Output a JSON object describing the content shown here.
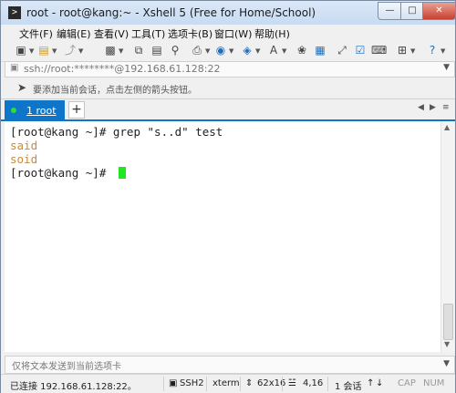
{
  "window": {
    "title": "root - root@kang:~ - Xshell 5 (Free for Home/School)"
  },
  "menu": [
    "文件(F)",
    "编辑(E)",
    "查看(V)",
    "工具(T)",
    "选项卡(B)",
    "窗口(W)",
    "帮助(H)"
  ],
  "address": {
    "value": "ssh://root:********@192.168.61.128:22"
  },
  "hint": {
    "text": "要添加当前会话，点击左侧的箭头按钮。"
  },
  "tab": {
    "label": "1 root",
    "add_label": "+"
  },
  "terminal": {
    "lines": [
      {
        "text": "[root@kang ~]# grep \"s..d\" test",
        "kind": "prompt"
      },
      {
        "text": "said",
        "kind": "output"
      },
      {
        "text": "soid",
        "kind": "output"
      },
      {
        "text": "[root@kang ~]# ",
        "kind": "prompt"
      }
    ],
    "output_color": "#c98b3a",
    "cursor_color": "#22e622"
  },
  "sendbar": {
    "placeholder": "仅将文本发送到当前选项卡"
  },
  "status": {
    "connection": "已连接 192.168.61.128:22。",
    "protocol": "SSH2",
    "term": "xterm",
    "size": "62x16",
    "position": "4,16",
    "sessions": "1 会话",
    "cap": "CAP",
    "num": "NUM"
  },
  "colors": {
    "tab_accent": "#0f75c8"
  }
}
